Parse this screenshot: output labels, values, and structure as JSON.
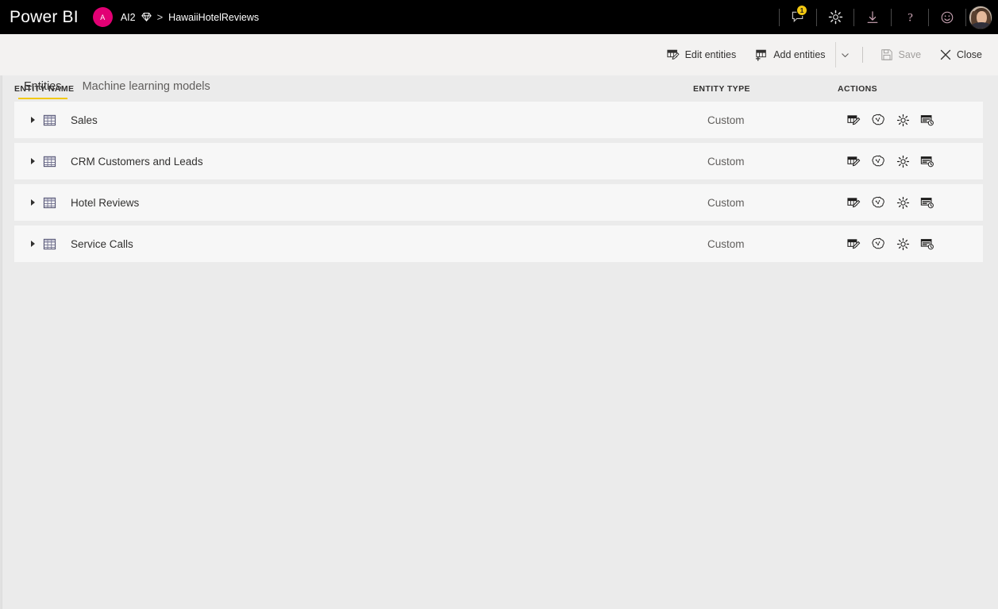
{
  "topbar": {
    "brand": "Power BI",
    "workspace_initial": "A",
    "workspace_name": "AI2",
    "breadcrumb_separator": ">",
    "dataflow_name": "HawaiiHotelReviews",
    "premium_icon": "diamond-icon",
    "notifications_icon": "comment-bubble-icon",
    "notifications_badge": "1",
    "settings_icon": "gear-icon",
    "download_icon": "download-icon",
    "help_icon": "question-mark-icon",
    "feedback_icon": "smiley-icon",
    "account_icon": "user-avatar"
  },
  "commandbar": {
    "edit_entities_label": "Edit entities",
    "edit_entities_icon": "table-edit-icon",
    "add_entities_label": "Add entities",
    "add_entities_icon": "table-add-icon",
    "add_entities_caret_icon": "chevron-down-icon",
    "save_label": "Save",
    "save_icon": "save-floppy-icon",
    "save_disabled": true,
    "close_label": "Close",
    "close_icon": "close-x-icon"
  },
  "tabs": [
    {
      "label": "Entities",
      "active": true
    },
    {
      "label": "Machine learning models",
      "active": false
    }
  ],
  "table": {
    "columns": [
      "ENTITY NAME",
      "ENTITY TYPE",
      "ACTIONS"
    ],
    "row_actions": [
      {
        "icon": "edit-table-icon",
        "label": "Edit"
      },
      {
        "icon": "ai-brain-icon",
        "label": "AI insights"
      },
      {
        "icon": "gear-icon",
        "label": "Settings"
      },
      {
        "icon": "incremental-refresh-icon",
        "label": "Incremental refresh"
      }
    ],
    "rows": [
      {
        "name": "Sales",
        "type": "Custom",
        "icon": "table-icon",
        "expander": "chevron-right-icon"
      },
      {
        "name": "CRM Customers and Leads",
        "type": "Custom",
        "icon": "table-icon",
        "expander": "chevron-right-icon"
      },
      {
        "name": "Hotel Reviews",
        "type": "Custom",
        "icon": "table-icon",
        "expander": "chevron-right-icon"
      },
      {
        "name": "Service Calls",
        "type": "Custom",
        "icon": "table-icon",
        "expander": "chevron-right-icon"
      }
    ]
  },
  "colors": {
    "topbar_bg": "#000000",
    "accent_yellow": "#f2c811",
    "workspace_pink": "#e20074",
    "page_bg": "#ebebeb",
    "row_bg": "#f7f7f7",
    "text_primary": "#323130",
    "text_secondary": "#605e5c"
  }
}
